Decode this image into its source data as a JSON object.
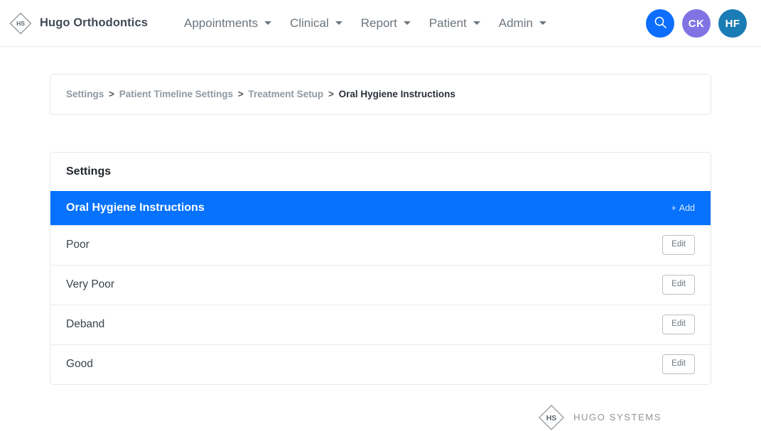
{
  "header": {
    "brand_name": "Hugo Orthodontics",
    "logo_text": "HS",
    "logo_icon": "diamond-hs-logo",
    "nav_items": [
      {
        "label": "Appointments",
        "icon": "chevron-down-icon"
      },
      {
        "label": "Clinical",
        "icon": "chevron-down-icon"
      },
      {
        "label": "Report",
        "icon": "chevron-down-icon"
      },
      {
        "label": "Patient",
        "icon": "chevron-down-icon"
      },
      {
        "label": "Admin",
        "icon": "chevron-down-icon"
      }
    ],
    "search_icon": "search-icon",
    "avatars": [
      {
        "initials": "CK",
        "color": "#8273e4"
      },
      {
        "initials": "HF",
        "color": "#1a7cb5"
      }
    ],
    "search_color": "#0d6efd"
  },
  "breadcrumb": {
    "separator": ">",
    "items": [
      {
        "label": "Settings",
        "current": false
      },
      {
        "label": "Patient Timeline Settings",
        "current": false
      },
      {
        "label": "Treatment Setup",
        "current": false
      },
      {
        "label": "Oral Hygiene Instructions",
        "current": true
      }
    ]
  },
  "settings_card": {
    "title": "Settings",
    "section_title": "Oral Hygiene Instructions",
    "section_color": "#0672fd",
    "add_label": "Add",
    "add_icon": "plus-icon",
    "edit_label": "Edit",
    "rows": [
      {
        "label": "Poor"
      },
      {
        "label": "Very Poor"
      },
      {
        "label": "Deband"
      },
      {
        "label": "Good"
      }
    ]
  },
  "footer": {
    "logo_text": "HS",
    "logo_icon": "diamond-hs-logo",
    "company": "HUGO SYSTEMS"
  }
}
